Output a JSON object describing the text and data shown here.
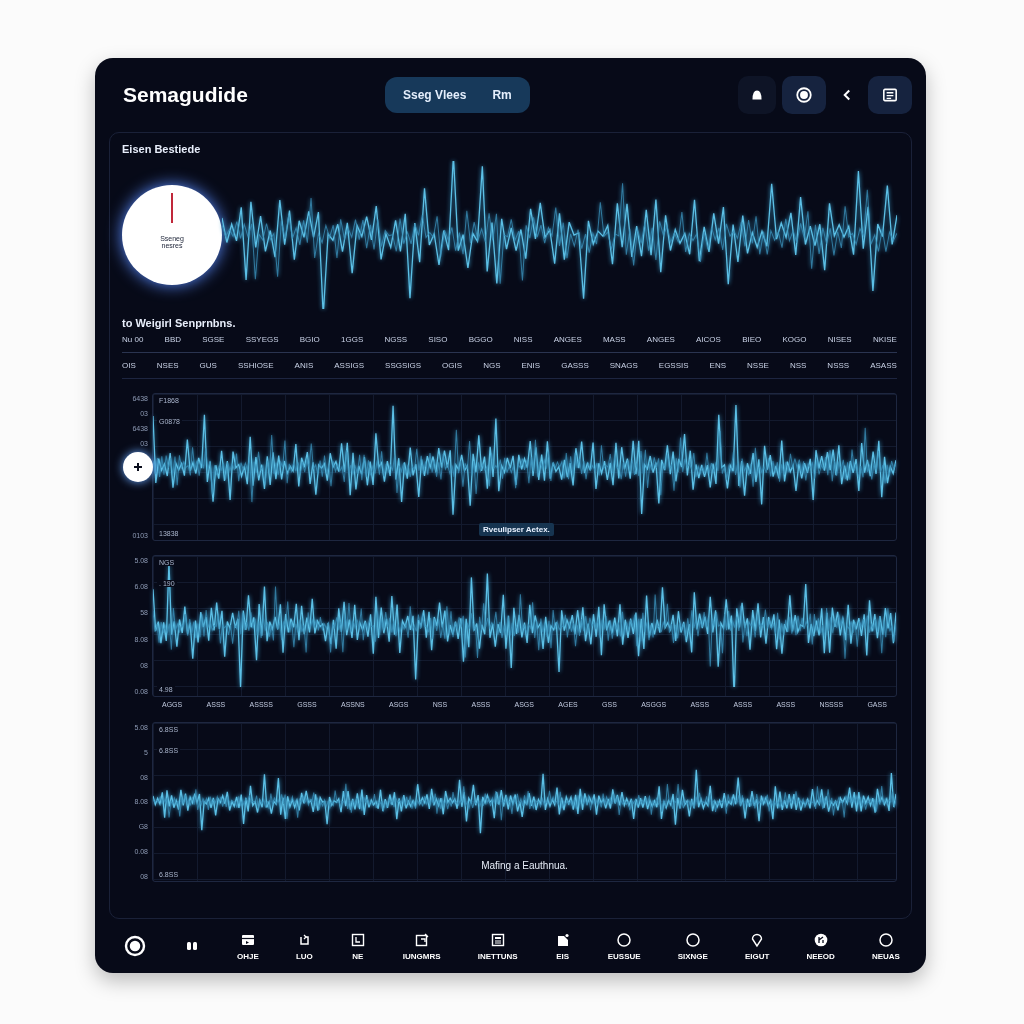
{
  "app": {
    "title": "Semagudide"
  },
  "mode_pill": {
    "labels": [
      "Sseg Vlees",
      "Rm"
    ]
  },
  "toolbar": [
    {
      "kind": "bell"
    },
    {
      "kind": "record"
    },
    {
      "kind": "back"
    },
    {
      "kind": "list"
    }
  ],
  "overview": {
    "title": "Eisen Bestiede",
    "dial": {
      "label": "Sseneg nesres"
    },
    "subtitle": "to Weigirl Senprnbns.",
    "label_rows": [
      [
        "Nu 00",
        "BBD",
        "SGSE",
        "SSYEGS",
        "BGIO",
        "1GGS",
        "NGSS",
        "SISO",
        "BGGO",
        "NISS",
        "ANGES",
        "MASS",
        "ANGES",
        "AICOS",
        "BIEO",
        "KOGO",
        "NISES",
        "NKISE"
      ],
      [
        "OIS",
        "NSES",
        "GUS",
        "SSHIOSE",
        "ANIS",
        "ASSIGS",
        "SSGSIGS",
        "OGIS",
        "NGS",
        "ENIS",
        "GASSS",
        "SNAGS",
        "EGSSIS",
        "ENS",
        "NSSE",
        "NSS",
        "NSSS",
        "ASASS"
      ]
    ]
  },
  "charts": [
    {
      "kind": "tagged",
      "y_labels": [
        "6438",
        "03",
        "6438",
        "03",
        "0103"
      ],
      "inner_labels": [
        "F1868",
        "G0878",
        "13838"
      ],
      "tag": "Rveulipser Aetex."
    },
    {
      "kind": "axis",
      "y_labels": [
        "5.08",
        "6.08",
        "58",
        "8.08",
        "08",
        "0.08"
      ],
      "inner_labels": [
        "NGS",
        ". 190",
        "4.98"
      ],
      "x_labels": [
        "AGGS",
        "ASSS",
        "ASSSS",
        "GSSS",
        "ASSNS",
        "ASGS",
        "NSS",
        "ASSS",
        "ASGS",
        "AGES",
        "GSS",
        "ASGGS",
        "ASSS",
        "ASSS",
        "ASSS",
        "NSSSS",
        "GASS"
      ]
    },
    {
      "kind": "caption",
      "y_labels": [
        "5.08",
        "5",
        "08",
        "8.08",
        "G8",
        "0.08",
        "08"
      ],
      "inner_labels": [
        "6.8SS",
        "6.8SS",
        "6.8SS"
      ],
      "caption": "Mafing a Eauthnua."
    }
  ],
  "nav": {
    "items": [
      {
        "kind": "record"
      },
      {
        "kind": "pause"
      },
      {
        "kind": "tray",
        "label": "OHJE"
      },
      {
        "kind": "return",
        "label": "LUO"
      },
      {
        "kind": "frame",
        "label": "NE"
      },
      {
        "kind": "edit",
        "label": "IUNGMRS"
      },
      {
        "kind": "doc",
        "label": "INETTUNS"
      },
      {
        "kind": "file",
        "label": "EIS"
      },
      {
        "kind": "ring",
        "label": "EUSSUE"
      },
      {
        "kind": "ring",
        "label": "SIXNGE"
      },
      {
        "kind": "pin",
        "label": "EIGUT"
      },
      {
        "kind": "mark",
        "label": "NEEOD"
      },
      {
        "kind": "ring",
        "label": "NEUAS"
      }
    ]
  }
}
